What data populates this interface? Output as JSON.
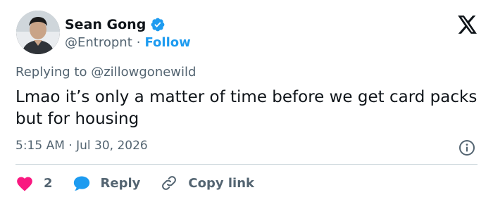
{
  "author": {
    "display_name": "Sean Gong",
    "handle": "@Entropnt",
    "separator": "·",
    "follow_label": "Follow",
    "verified": true
  },
  "brand": {
    "logo_icon": "x-logo-icon"
  },
  "tweet": {
    "reply_context": "Replying to @zillowgonewild",
    "text": "Lmao it’s only a matter of time before we get card packs but for housing",
    "timestamp": "5:15 AM · Jul 30, 2026"
  },
  "actions": {
    "like_count": "2",
    "reply_label": "Reply",
    "copy_link_label": "Copy link"
  },
  "colors": {
    "accent": "#1d9bf0",
    "like": "#f91880",
    "text": "#0f1419",
    "secondary": "#536471",
    "divider": "#cfd9de"
  }
}
